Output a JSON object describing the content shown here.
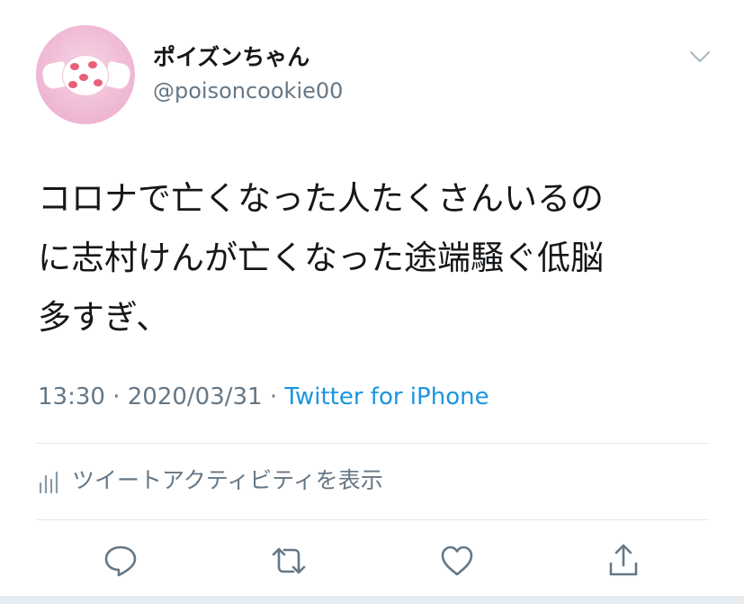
{
  "author": {
    "display_name": "ポイズンちゃん",
    "handle": "@poisoncookie00",
    "avatar_icon": "candy-avatar"
  },
  "menu": {
    "icon": "chevron-down-icon"
  },
  "tweet": {
    "lines": [
      "コロナで亡くなった人たくさんいるの",
      "に志村けんが亡くなった途端騒ぐ低脳",
      "多すぎ、"
    ]
  },
  "meta": {
    "time": "13:30",
    "sep1": " · ",
    "date": "2020/03/31",
    "sep2": " · ",
    "source": "Twitter for iPhone"
  },
  "activity": {
    "icon": "bar-chart-icon",
    "label": "ツイートアクティビティを表示"
  },
  "actions": [
    {
      "name": "reply",
      "icon": "reply-icon"
    },
    {
      "name": "retweet",
      "icon": "retweet-icon"
    },
    {
      "name": "like",
      "icon": "heart-icon"
    },
    {
      "name": "share",
      "icon": "share-icon"
    }
  ],
  "colors": {
    "text": "#14171a",
    "secondary": "#657786",
    "link": "#1b95e0",
    "divider": "#e1e8ed",
    "avatar_bg": "#f0bcd6"
  }
}
